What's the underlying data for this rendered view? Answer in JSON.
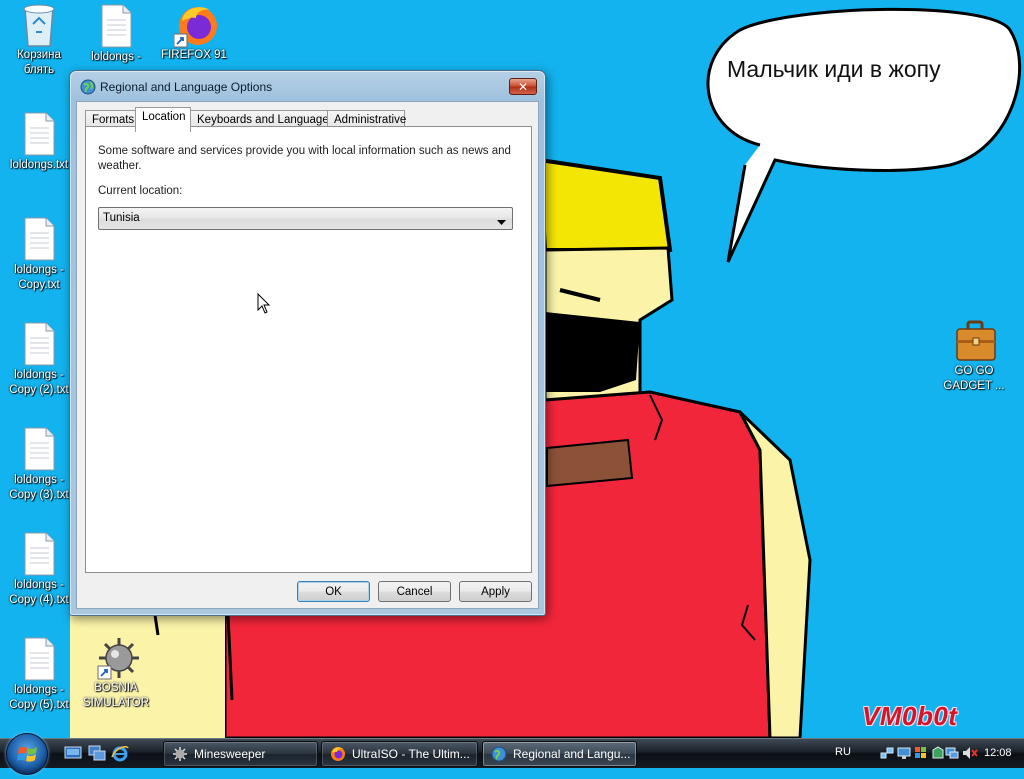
{
  "desktop": {
    "speech_bubble_text": "Мальчик иди в жопу",
    "signature": "VM0b0t",
    "icons": [
      {
        "label": "Корзина\nблять",
        "icon": "recycle-bin-icon"
      },
      {
        "label": "loldongs -",
        "icon": "text-file-icon"
      },
      {
        "label": "FIREFOX 91",
        "icon": "firefox-icon"
      },
      {
        "label": "loldongs.txt",
        "icon": "text-file-icon"
      },
      {
        "label": "loldongs -\nCopy.txt",
        "icon": "text-file-icon"
      },
      {
        "label": "loldongs -\nCopy (2).txt",
        "icon": "text-file-icon"
      },
      {
        "label": "loldongs -\nCopy (3).txt",
        "icon": "text-file-icon"
      },
      {
        "label": "loldongs -\nCopy (4).txt",
        "icon": "text-file-icon"
      },
      {
        "label": "loldongs -\nCopy (5).txt",
        "icon": "text-file-icon"
      },
      {
        "label": "BOSNIA\nSIMULATOR",
        "icon": "minesweeper-mine-icon"
      },
      {
        "label": "GO GO\nGADGET ...",
        "icon": "briefcase-icon"
      }
    ]
  },
  "window": {
    "title": "Regional and Language Options",
    "close_label": "✕",
    "tabs": [
      {
        "label": "Formats",
        "active": false
      },
      {
        "label": "Location",
        "active": true
      },
      {
        "label": "Keyboards and Languages",
        "active": false
      },
      {
        "label": "Administrative",
        "active": false
      }
    ],
    "info_text": "Some software and services provide you with local information such as news and weather.",
    "current_location_label": "Current location:",
    "current_location_value": "Tunisia",
    "buttons": {
      "ok": "OK",
      "cancel": "Cancel",
      "apply": "Apply"
    }
  },
  "taskbar": {
    "tasks": [
      {
        "label": "Minesweeper",
        "icon": "minesweeper-icon"
      },
      {
        "label": "UltraISO - The Ultim...",
        "icon": "firefox-icon"
      },
      {
        "label": "Regional and Langu...",
        "icon": "regional-options-icon"
      }
    ],
    "language": "RU",
    "clock": "12:08"
  }
}
